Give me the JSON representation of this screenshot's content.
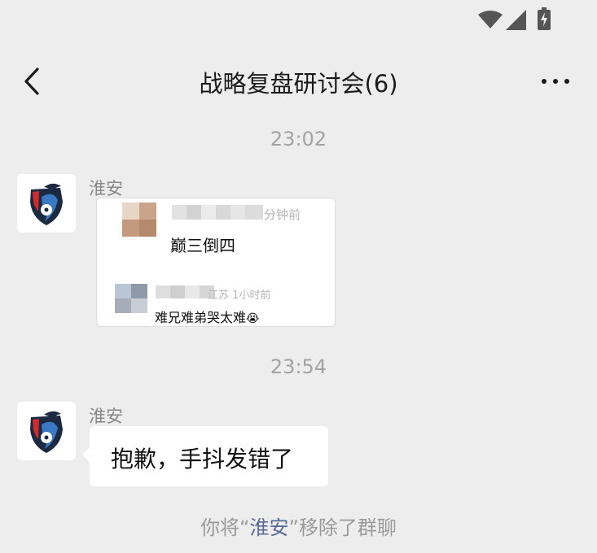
{
  "status_bar": {
    "icons": [
      "wifi-icon",
      "signal-icon",
      "battery-charging-icon"
    ]
  },
  "header": {
    "title": "战略复盘研讨会(6)",
    "back_icon": "chevron-left-icon",
    "more_icon": "more-icon"
  },
  "messages": [
    {
      "time": "23:02",
      "sender": "淮安",
      "type": "forwarded-screenshot",
      "content": {
        "comment_1": {
          "time_suffix": "分钟前",
          "text": "巅三倒四"
        },
        "comment_2": {
          "location_time": "江苏 1小时前",
          "text": "难兄难弟哭太难",
          "emoji": "😭"
        }
      }
    },
    {
      "time": "23:54",
      "sender": "淮安",
      "type": "text",
      "text": "抱歉，手抖发错了"
    }
  ],
  "system_notice": {
    "prefix": "你将“",
    "name": "淮安",
    "suffix": "”移除了群聊"
  },
  "colors": {
    "background": "#ededed",
    "bubble": "#ffffff",
    "link_name": "#576b95",
    "meta_text": "#a3a3a3"
  }
}
